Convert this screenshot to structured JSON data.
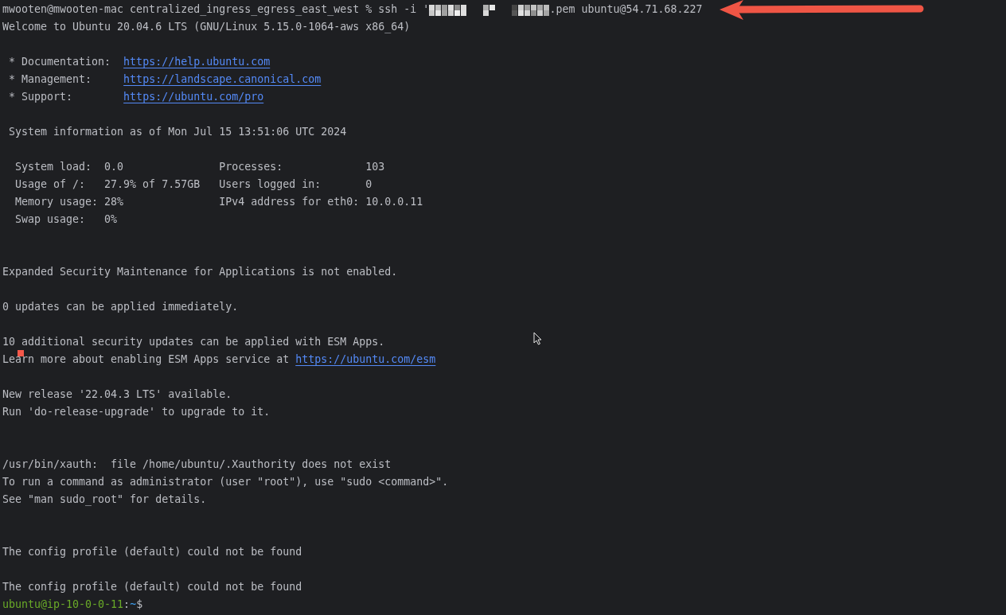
{
  "terminal": {
    "lines": [
      {
        "segments": [
          {
            "kind": "plain",
            "text": "mwooten@mwooten-mac centralized_ingress_egress_east_west % ssh -i '"
          },
          {
            "kind": "redacted"
          },
          {
            "kind": "plain",
            "text": ".pem ubuntu@54.71.68.227"
          }
        ]
      },
      {
        "segments": [
          {
            "kind": "plain",
            "text": "Welcome to Ubuntu 20.04.6 LTS (GNU/Linux 5.15.0-1064-aws x86_64)"
          }
        ]
      },
      {
        "kind": "blank"
      },
      {
        "segments": [
          {
            "kind": "plain",
            "text": " * Documentation:  "
          },
          {
            "kind": "link",
            "text": "https://help.ubuntu.com"
          }
        ]
      },
      {
        "segments": [
          {
            "kind": "plain",
            "text": " * Management:     "
          },
          {
            "kind": "link",
            "text": "https://landscape.canonical.com"
          }
        ]
      },
      {
        "segments": [
          {
            "kind": "plain",
            "text": " * Support:        "
          },
          {
            "kind": "link",
            "text": "https://ubuntu.com/pro"
          }
        ]
      },
      {
        "kind": "blank"
      },
      {
        "segments": [
          {
            "kind": "plain",
            "text": " System information as of Mon Jul 15 13:51:06 UTC 2024"
          }
        ]
      },
      {
        "kind": "blank"
      },
      {
        "segments": [
          {
            "kind": "plain",
            "text": "  System load:  0.0               Processes:             103"
          }
        ]
      },
      {
        "segments": [
          {
            "kind": "plain",
            "text": "  Usage of /:   27.9% of 7.57GB   Users logged in:       0"
          }
        ]
      },
      {
        "segments": [
          {
            "kind": "plain",
            "text": "  Memory usage: 28%               IPv4 address for eth0: 10.0.0.11"
          }
        ]
      },
      {
        "segments": [
          {
            "kind": "plain",
            "text": "  Swap usage:   0%"
          }
        ]
      },
      {
        "kind": "blank"
      },
      {
        "kind": "blank"
      },
      {
        "segments": [
          {
            "kind": "plain",
            "text": "Expanded Security Maintenance for Applications is not enabled."
          }
        ]
      },
      {
        "kind": "blank"
      },
      {
        "segments": [
          {
            "kind": "plain",
            "text": "0 updates can be applied immediately."
          }
        ]
      },
      {
        "kind": "blank"
      },
      {
        "segments": [
          {
            "kind": "plain",
            "text": "10 additional security updates can be applied with ESM Apps."
          }
        ]
      },
      {
        "segments": [
          {
            "kind": "plain",
            "text": "Learn more about enabling ESM Apps service at "
          },
          {
            "kind": "link",
            "text": "https://ubuntu.com/esm"
          }
        ]
      },
      {
        "kind": "blank"
      },
      {
        "segments": [
          {
            "kind": "plain",
            "text": "New release '22.04.3 LTS' available."
          }
        ]
      },
      {
        "segments": [
          {
            "kind": "plain",
            "text": "Run 'do-release-upgrade' to upgrade to it."
          }
        ]
      },
      {
        "kind": "blank"
      },
      {
        "kind": "blank"
      },
      {
        "segments": [
          {
            "kind": "plain",
            "text": "/usr/bin/xauth:  file /home/ubuntu/.Xauthority does not exist"
          }
        ]
      },
      {
        "segments": [
          {
            "kind": "plain",
            "text": "To run a command as administrator (user \"root\"), use \"sudo <command>\"."
          }
        ]
      },
      {
        "segments": [
          {
            "kind": "plain",
            "text": "See \"man sudo_root\" for details."
          }
        ]
      },
      {
        "kind": "blank"
      },
      {
        "kind": "blank"
      },
      {
        "segments": [
          {
            "kind": "plain",
            "text": "The config profile (default) could not be found"
          }
        ]
      },
      {
        "kind": "blank"
      },
      {
        "segments": [
          {
            "kind": "plain",
            "text": "The config profile (default) could not be found"
          }
        ]
      },
      {
        "segments": [
          {
            "kind": "user",
            "text": "ubuntu@ip-10-0-0-11"
          },
          {
            "kind": "plain",
            "text": ":"
          },
          {
            "kind": "path",
            "text": "~"
          },
          {
            "kind": "plain",
            "text": "$"
          }
        ]
      }
    ]
  },
  "overlays": [
    {
      "kind": "arrow"
    },
    {
      "kind": "marker"
    },
    {
      "kind": "mouse-pointer"
    }
  ]
}
